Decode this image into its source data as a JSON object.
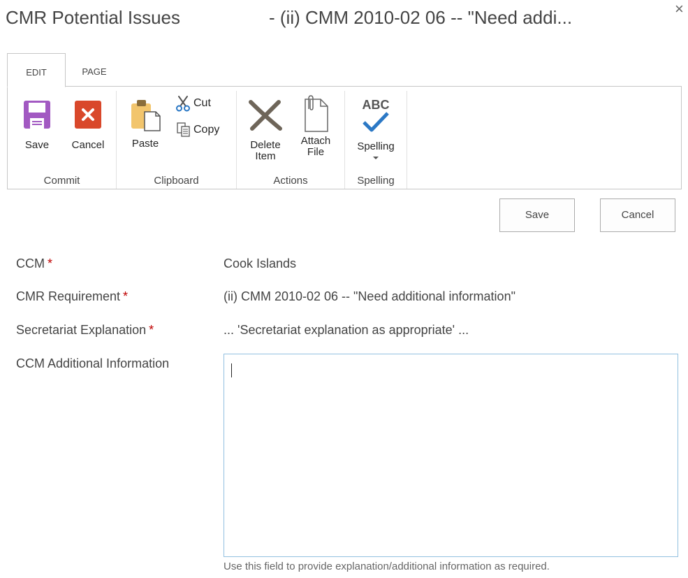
{
  "dialog": {
    "title": "CMR Potential Issues",
    "title_item": "- (ii) CMM 2010-02 06 -- \"Need addi...",
    "close_glyph": "×"
  },
  "ribbon": {
    "tabs": [
      {
        "label": "EDIT",
        "active": true
      },
      {
        "label": "PAGE",
        "active": false
      }
    ],
    "groups": {
      "commit": {
        "label": "Commit",
        "save": "Save",
        "cancel": "Cancel"
      },
      "clipboard": {
        "label": "Clipboard",
        "paste": "Paste",
        "cut": "Cut",
        "copy": "Copy"
      },
      "actions": {
        "label": "Actions",
        "delete_line1": "Delete",
        "delete_line2": "Item",
        "attach_line1": "Attach",
        "attach_line2": "File"
      },
      "spelling": {
        "label": "Spelling",
        "button": "Spelling",
        "abc": "ABC"
      }
    }
  },
  "form_buttons": {
    "save": "Save",
    "cancel": "Cancel"
  },
  "fields": [
    {
      "label": "CCM",
      "required": "*",
      "value": "Cook Islands"
    },
    {
      "label": "CMR Requirement",
      "required": "*",
      "value": "(ii) CMM 2010-02 06 -- \"Need additional information\""
    },
    {
      "label": "Secretariat Explanation",
      "required": "*",
      "value": "... 'Secretariat explanation as appropriate' ..."
    },
    {
      "label": "CCM Additional Information",
      "value": "",
      "hint": "Use this field to provide explanation/additional information as required."
    }
  ],
  "colors": {
    "save_icon": "#a259c2",
    "cancel_icon": "#d9482b",
    "spell_check": "#2b78c5",
    "delete_x": "#6e6559",
    "required": "#bf0000",
    "textarea_border": "#92c0e0"
  }
}
